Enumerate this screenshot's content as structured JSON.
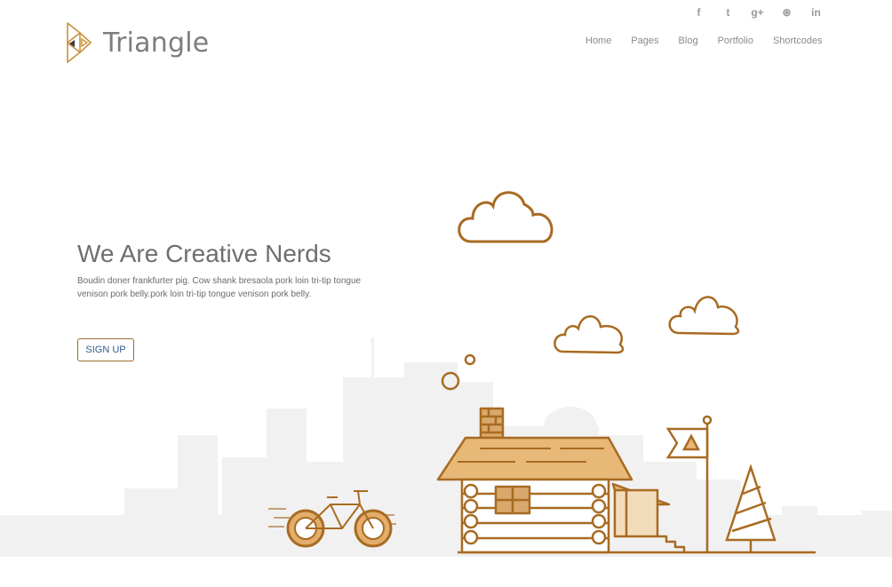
{
  "brand": {
    "name": "Triangle",
    "accent": "#c9923d",
    "line_color": "#a86b22"
  },
  "social": [
    {
      "icon": "facebook-icon",
      "glyph": "f"
    },
    {
      "icon": "twitter-icon",
      "glyph": "t"
    },
    {
      "icon": "google-plus-icon",
      "glyph": "g+"
    },
    {
      "icon": "dribbble-icon",
      "glyph": "⊛"
    },
    {
      "icon": "linkedin-icon",
      "glyph": "in"
    }
  ],
  "nav": [
    "Home",
    "Pages",
    "Blog",
    "Portfolio",
    "Shortcodes"
  ],
  "hero": {
    "title": "We Are Creative Nerds",
    "description": "Boudin doner frankfurter pig. Cow shank bresaola pork loin tri-tip tongue venison pork belly.pork loin tri-tip tongue venison pork belly.",
    "cta": "SIGN UP"
  }
}
